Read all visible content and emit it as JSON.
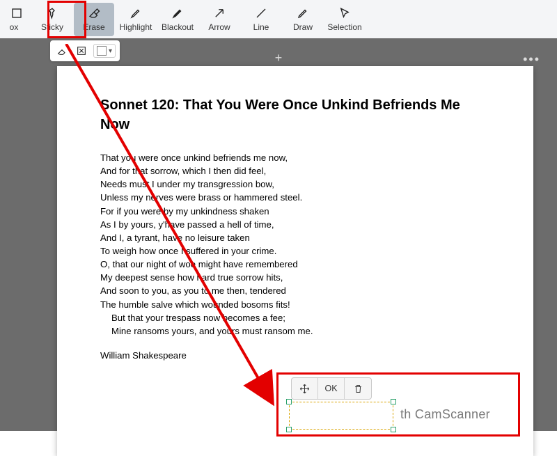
{
  "toolbar": {
    "items": [
      {
        "id": "box",
        "label": "ox"
      },
      {
        "id": "sticky",
        "label": "Sticky"
      },
      {
        "id": "erase",
        "label": "Erase"
      },
      {
        "id": "highlight",
        "label": "Highlight"
      },
      {
        "id": "blackout",
        "label": "Blackout"
      },
      {
        "id": "arrow",
        "label": "Arrow"
      },
      {
        "id": "line",
        "label": "Line"
      },
      {
        "id": "draw",
        "label": "Draw"
      },
      {
        "id": "selection",
        "label": "Selection"
      }
    ],
    "highlighted_index": 2
  },
  "document": {
    "title": "Sonnet 120: That You Were Once Unkind Befriends Me Now",
    "lines": [
      "That you were once unkind befriends me now,",
      "And for that sorrow, which I then did feel,",
      "Needs must I under my transgression bow,",
      "Unless my nerves were brass or hammered steel.",
      "For if you were by my unkindness shaken",
      "As I by yours, y'have passed a hell of time,",
      "And I, a tyrant, have no leisure taken",
      "To weigh how once I suffered in your crime.",
      "O, that our night of woe might have remembered",
      "My deepest sense how hard true sorrow hits,",
      "And soon to you, as you to me then, tendered",
      "The humble salve which wounded bosoms fits!"
    ],
    "couplet": [
      "But that your trespass now becomes a fee;",
      "Mine ransoms yours, and yours must ransom me."
    ],
    "author": "William Shakespeare",
    "watermark_fragment": "th CamScanner"
  },
  "erase_toolbar": {
    "ok_label": "OK"
  },
  "annotation": {
    "highlight_color": "#e30000"
  }
}
